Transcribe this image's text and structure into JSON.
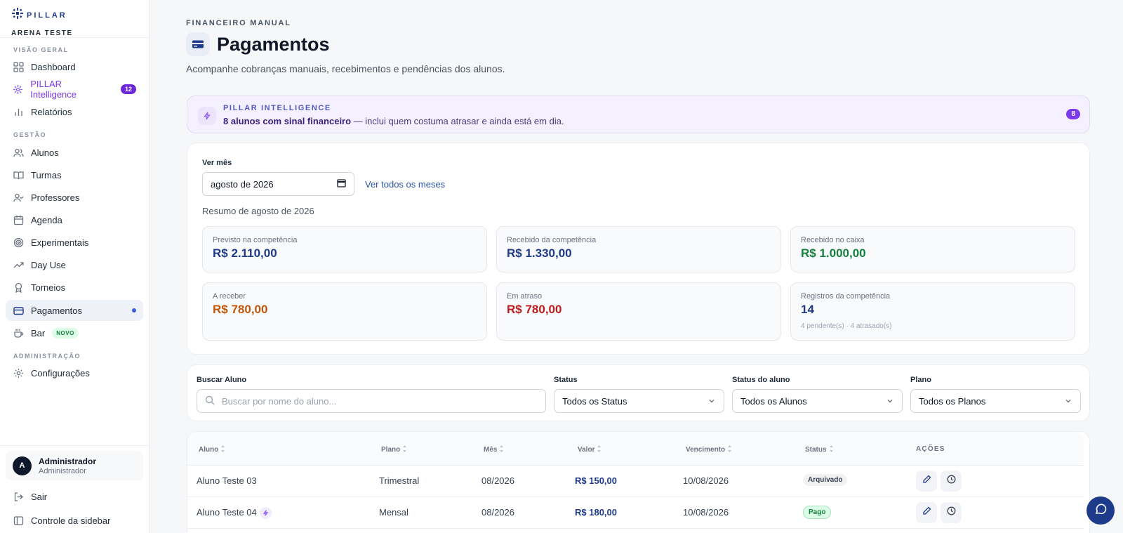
{
  "sidebar": {
    "brand": "PILLAR",
    "org": "ARENA TESTE",
    "sections": {
      "overview": "VISÃO GERAL",
      "management": "GESTÃO",
      "admin": "ADMINISTRAÇÃO"
    },
    "items": {
      "dashboard": "Dashboard",
      "intelligence": "PILLAR Intelligence",
      "intelligence_badge": "12",
      "reports": "Relatórios",
      "students": "Alunos",
      "classes": "Turmas",
      "teachers": "Professores",
      "agenda": "Agenda",
      "trials": "Experimentais",
      "day_use": "Day Use",
      "tournaments": "Torneios",
      "payments": "Pagamentos",
      "bar": "Bar",
      "bar_badge": "NOVO",
      "settings": "Configurações"
    },
    "user": {
      "initial": "A",
      "name": "Administrador",
      "role": "Administrador"
    },
    "logout": "Sair",
    "sidebar_control": "Controle da sidebar"
  },
  "header": {
    "eyebrow": "FINANCEIRO MANUAL",
    "title": "Pagamentos",
    "subtitle": "Acompanhe cobranças manuais, recebimentos e pendências dos alunos."
  },
  "intelligence": {
    "title": "PILLAR INTELLIGENCE",
    "highlight": "8 alunos com sinal financeiro",
    "text": " — inclui quem costuma atrasar e ainda está em dia.",
    "count": "8"
  },
  "summary": {
    "month_label": "Ver mês",
    "month_value": "agosto de 2026",
    "see_all": "Ver todos os meses",
    "title": "Resumo de agosto de 2026",
    "stats": {
      "forecast": {
        "label": "Previsto na competência",
        "value": "R$ 2.110,00"
      },
      "received_comp": {
        "label": "Recebido da competência",
        "value": "R$ 1.330,00"
      },
      "received_cash": {
        "label": "Recebido no caixa",
        "value": "R$ 1.000,00"
      },
      "to_receive": {
        "label": "A receber",
        "value": "R$ 780,00"
      },
      "overdue": {
        "label": "Em atraso",
        "value": "R$ 780,00"
      },
      "records": {
        "label": "Registros da competência",
        "value": "14",
        "note": "4 pendente(s) · 4 atrasado(s)"
      }
    }
  },
  "filters": {
    "search_label": "Buscar Aluno",
    "search_placeholder": "Buscar por nome do aluno...",
    "status_label": "Status",
    "status_value": "Todos os Status",
    "student_status_label": "Status do aluno",
    "student_status_value": "Todos os Alunos",
    "plan_label": "Plano",
    "plan_value": "Todos os Planos"
  },
  "table": {
    "headers": {
      "student": "Aluno",
      "plan": "Plano",
      "month": "Mês",
      "value": "Valor",
      "due": "Vencimento",
      "status": "Status",
      "actions": "AÇÕES"
    },
    "rows": [
      {
        "student": "Aluno Teste 03",
        "plan": "Trimestral",
        "month": "08/2026",
        "value": "R$ 150,00",
        "due": "10/08/2026",
        "status": "Arquivado"
      },
      {
        "student": "Aluno Teste 04",
        "plan": "Mensal",
        "month": "08/2026",
        "value": "R$ 180,00",
        "due": "10/08/2026",
        "status": "Pago"
      }
    ]
  },
  "colors": {
    "primary": "#1e3a8a",
    "intelligence": "#7c3aed",
    "success": "#15803d",
    "warning": "#c2570c",
    "danger": "#b91c1c"
  }
}
